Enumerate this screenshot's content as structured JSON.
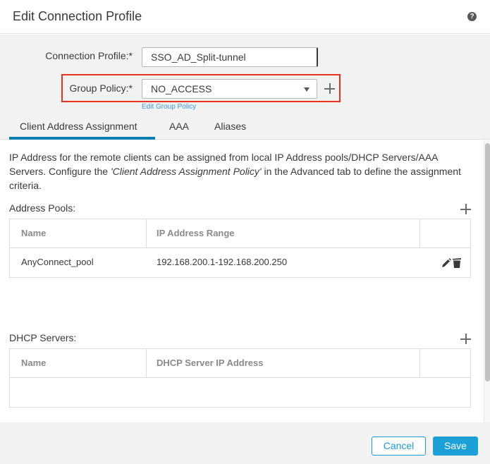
{
  "dialog": {
    "title": "Edit Connection Profile",
    "help_icon": "question-circle-icon",
    "help_glyph": "?"
  },
  "form": {
    "connection_profile": {
      "label": "Connection Profile:*",
      "value": "SSO_AD_Split-tunnel"
    },
    "group_policy": {
      "label": "Group Policy:*",
      "value": "NO_ACCESS",
      "add_icon": "plus-icon",
      "highlight_color": "#e5331c"
    },
    "edit_group_policy_link": "Edit Group Policy"
  },
  "tabs": [
    {
      "label": "Client Address Assignment",
      "active": true
    },
    {
      "label": "AAA",
      "active": false
    },
    {
      "label": "Aliases",
      "active": false
    }
  ],
  "content": {
    "description_part1": "IP Address for the remote clients can be assigned from local IP Address pools/DHCP Servers/AAA Servers. Configure the ",
    "description_italic": "'Client Address Assignment Policy'",
    "description_part2": " in the Advanced tab to define the assignment criteria.",
    "address_pools": {
      "label": "Address Pools:",
      "columns": [
        "Name",
        "IP Address Range",
        ""
      ],
      "rows": [
        {
          "name": "AnyConnect_pool",
          "range": "192.168.200.1-192.168.200.250",
          "actions": [
            "pencil-icon",
            "trash-icon"
          ]
        }
      ]
    },
    "dhcp_servers": {
      "label": "DHCP Servers:",
      "columns": [
        "Name",
        "DHCP Server IP Address",
        ""
      ],
      "rows": []
    }
  },
  "footer": {
    "cancel_label": "Cancel",
    "save_label": "Save"
  },
  "colors": {
    "accent": "#1ba0d7",
    "tab_active": "#0a7cb2",
    "link": "#3a9bd9"
  }
}
